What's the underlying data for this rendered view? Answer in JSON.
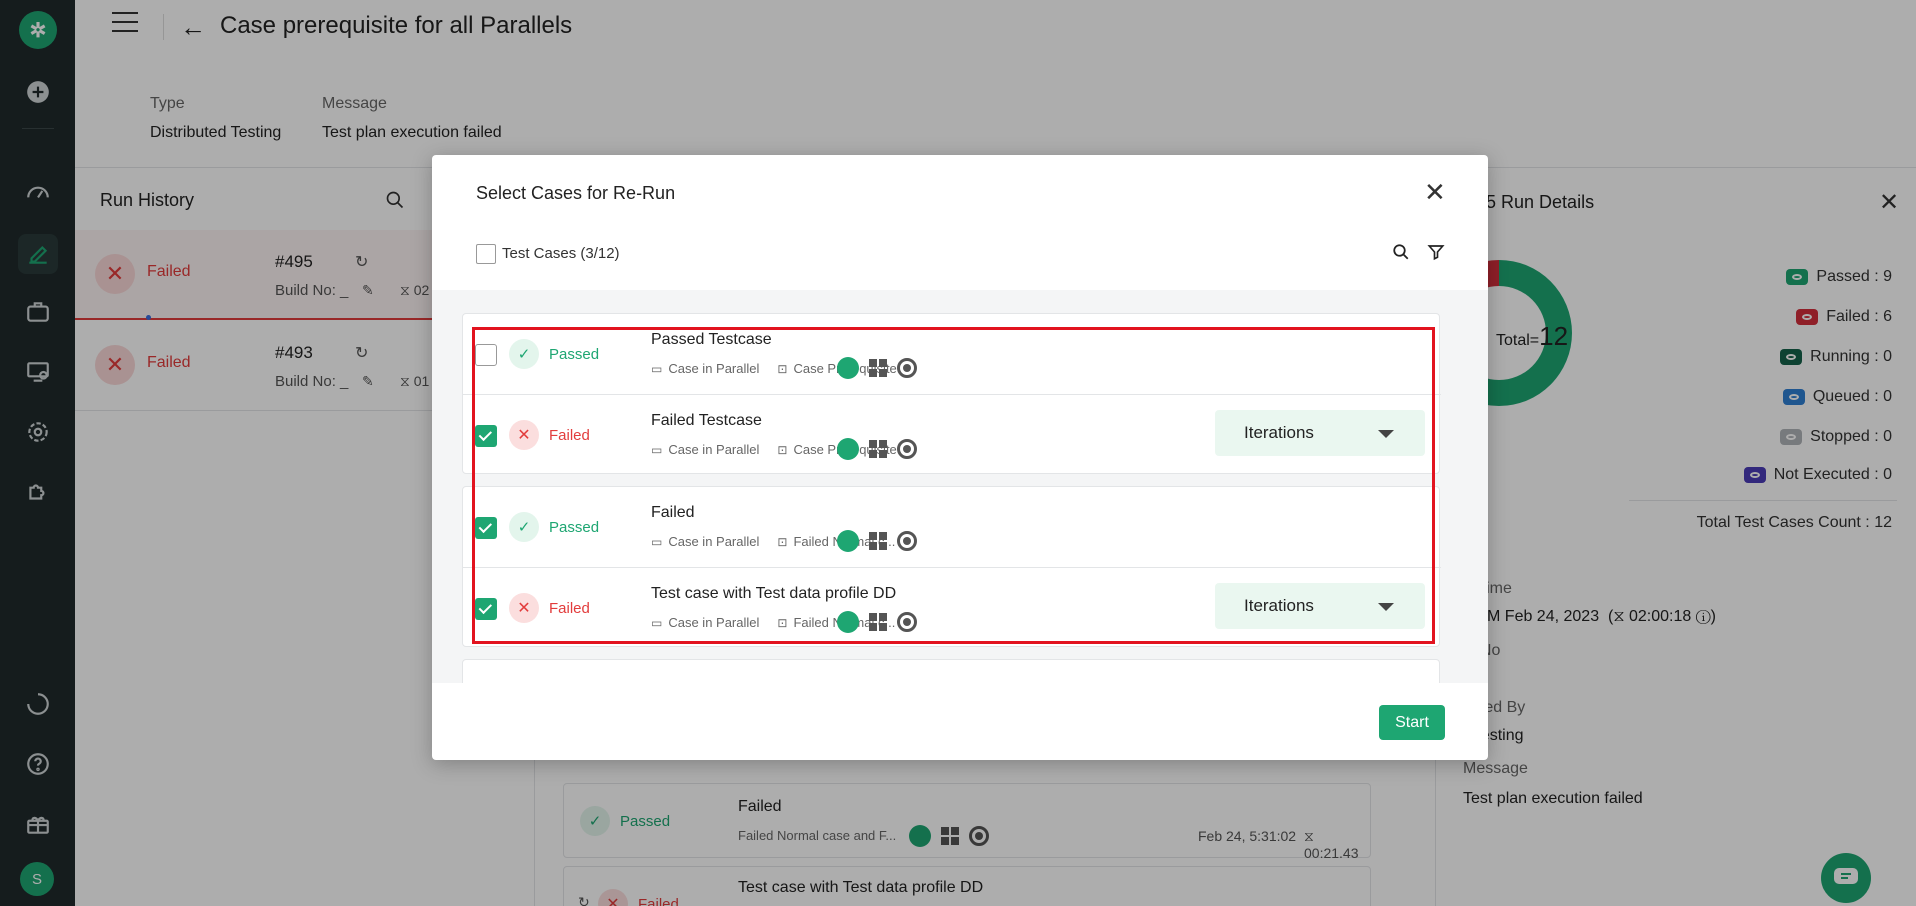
{
  "header": {
    "title": "Case prerequisite for all Parallels",
    "type_label": "Type",
    "type_value": "Distributed Testing",
    "message_label": "Message",
    "message_value": "Test plan execution failed"
  },
  "sidebar": {
    "avatar_initial": "S"
  },
  "run_history": {
    "title": "Run History",
    "items": [
      {
        "status": "Failed",
        "run": "#495",
        "build": "Build No: _",
        "extra": "02"
      },
      {
        "status": "Failed",
        "run": "#493",
        "build": "Build No: _",
        "extra": "01"
      }
    ]
  },
  "background_list": [
    {
      "status": "Passed",
      "name": "Failed",
      "sub": "Failed Normal case and F...",
      "time": "Feb 24, 5:31:02",
      "duration": "00:21.43"
    },
    {
      "status": "Failed",
      "name": "Test case with Test data profile DD"
    }
  ],
  "right_panel": {
    "title": "95 Run Details",
    "total_label": "Total=",
    "total_value": "12",
    "legend": [
      {
        "label": "Passed : 9",
        "color": "#1ea672"
      },
      {
        "label": "Failed : 6",
        "color": "#d32f3c"
      },
      {
        "label": "Running : 0",
        "color": "#16624a"
      },
      {
        "label": "Queued : 0",
        "color": "#2f7fd3"
      },
      {
        "label": "Stopped : 0",
        "color": "#b0b4b8"
      },
      {
        "label": "Not Executed : 0",
        "color": "#4b3bb7"
      }
    ],
    "chart_data": {
      "type": "pie",
      "categories": [
        "Passed",
        "Failed"
      ],
      "values": [
        9,
        3
      ],
      "colors": [
        "#1ea672",
        "#d32f3c"
      ]
    },
    "total_count": "Total Test Cases Count : 12",
    "start_time_label": "rt Time",
    "start_time_value": "4 PM Feb 24, 2023",
    "duration": "02:00:18",
    "build_label": "ld No",
    "build_value": "-",
    "executed_by_label": "cuted By",
    "executed_by_value": "n testing",
    "message_label": "Message",
    "message_value": "Test plan execution failed"
  },
  "modal": {
    "title": "Select Cases for Re-Run",
    "select_all_label": "Test Cases (3/12)",
    "start_label": "Start",
    "iterations_label": "Iterations",
    "groups": [
      {
        "rows": [
          {
            "checked": false,
            "status": "Passed",
            "name": "Passed Testcase",
            "type": "Case in Parallel",
            "suite": "Case Prerequisite",
            "iterations": false
          },
          {
            "checked": true,
            "status": "Failed",
            "name": "Failed Testcase",
            "type": "Case in Parallel",
            "suite": "Case Prerequisite",
            "iterations": true
          }
        ]
      },
      {
        "rows": [
          {
            "checked": true,
            "status": "Passed",
            "name": "Failed",
            "type": "Case in Parallel",
            "suite": "Failed Normal c...",
            "iterations": false
          },
          {
            "checked": true,
            "status": "Failed",
            "name": "Test case with Test data profile DD",
            "type": "Case in Parallel",
            "suite": "Failed Normal c...",
            "iterations": true
          }
        ]
      }
    ]
  }
}
